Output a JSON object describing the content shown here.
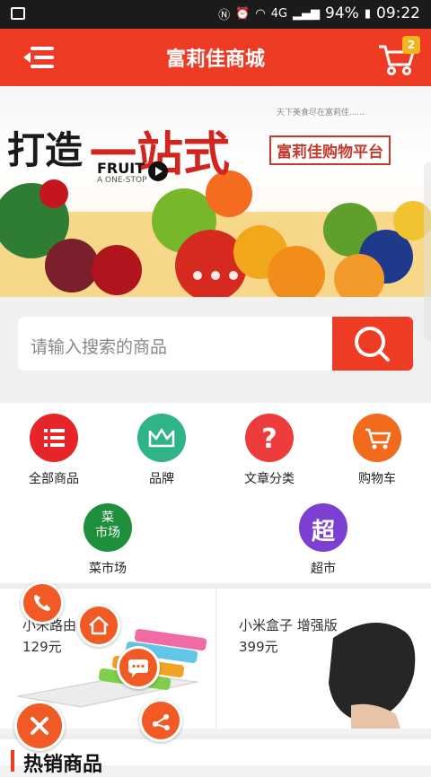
{
  "status": {
    "battery": "94%",
    "time": "09:22",
    "network": "4G"
  },
  "header": {
    "title": "富莉佳商城",
    "cart_count": "2"
  },
  "banner": {
    "headline_left": "打造",
    "headline_right": "一站式",
    "tagline": "富莉佳购物平台",
    "small_text": "天下美食尽在富莉佳......",
    "fruit_word": "FRUIT",
    "fruit_sub": "A ONE-STOP"
  },
  "search": {
    "placeholder": "请输入搜索的商品"
  },
  "categories": [
    {
      "label": "全部商品",
      "color": "#e8242b",
      "icon": "list-icon"
    },
    {
      "label": "品牌",
      "color": "#2fb48a",
      "icon": "crown-icon"
    },
    {
      "label": "文章分类",
      "color": "#ee3b3b",
      "icon": "question-icon"
    },
    {
      "label": "购物车",
      "color": "#f26b1d",
      "icon": "cart-icon"
    },
    {
      "label": "菜市场",
      "color": "#1e8f3a",
      "icon": "market-icon",
      "badge": "菜\n市场"
    },
    {
      "label": "超市",
      "color": "#7b3fd1",
      "icon": "supermarket-icon",
      "badge": "超"
    }
  ],
  "products": [
    {
      "name": "小米路由",
      "price": "129元"
    },
    {
      "name": "小米盒子 增强版",
      "price": "399元"
    }
  ],
  "section": {
    "title": "热销商品"
  }
}
